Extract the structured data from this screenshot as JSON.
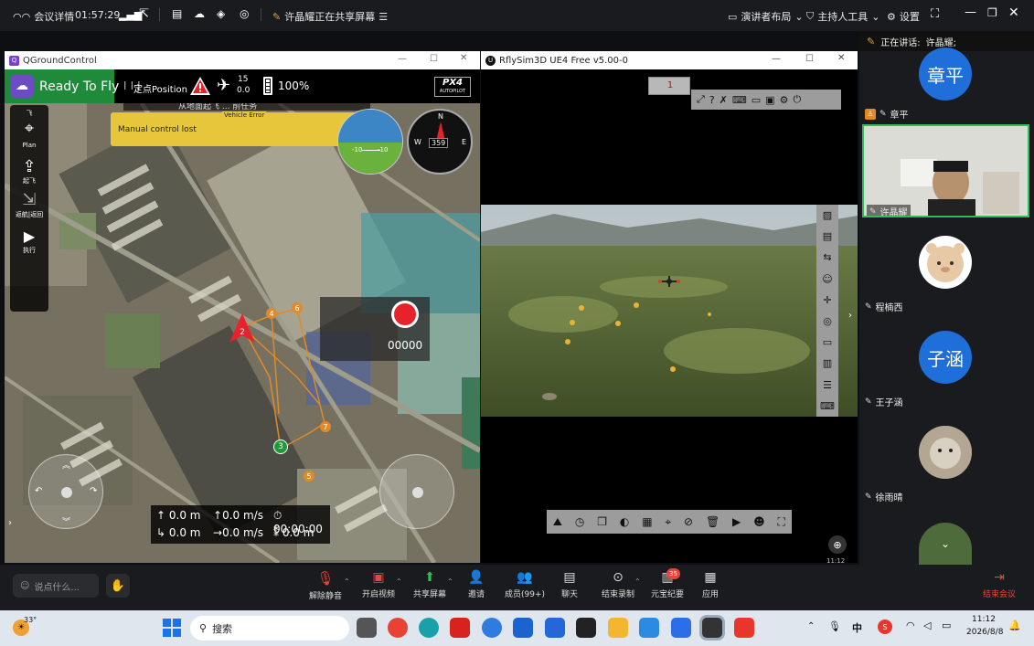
{
  "topbar": {
    "meeting_label": "会议详情",
    "time": "01:57:29",
    "sharing_text": "许晶耀正在共享屏幕",
    "layout_label": "演讲者布局",
    "host_tools_label": "主持人工具",
    "settings_label": "设置"
  },
  "qgc": {
    "window_title": "QGroundControl",
    "status": "Ready To Fly",
    "flight_mode": "定点Position",
    "satellites": "15",
    "hdop": "0.0",
    "battery": "100%",
    "brand": "PX4",
    "brand_sub": "AUTOPILOT",
    "toolbar": {
      "top_label": "飞",
      "plan": "Plan",
      "takeoff": "起飞",
      "return": "返航|返回",
      "execute": "执行"
    },
    "banner_text": "从地面起飞 ... 前任务",
    "vehicle_error_title": "Vehicle Error",
    "vehicle_error_msg": "Manual control lost",
    "compass_heading": "359",
    "compass_n": "N",
    "compass_e": "E",
    "compass_w": "W",
    "attitude_left": "-10",
    "attitude_right": "-10",
    "record_counter": "00000",
    "telemetry": {
      "alt": "0.0 m",
      "vspeed": "0.0 m/s",
      "time": "00:00:00",
      "dist": "0.0 m",
      "hspeed": "0.0 m/s",
      "dist_home": "0.0 m"
    },
    "waypoints": [
      "2",
      "3",
      "4",
      "5",
      "6",
      "7"
    ]
  },
  "rfly": {
    "window_title": "RflySim3D UE4 Free v5.00-0",
    "vehicle_id_badge": "1",
    "clock": "11:12"
  },
  "participants": {
    "speaking_label": "正在讲话:",
    "speaking_name": "许晶耀;",
    "list": [
      {
        "name": "章平",
        "avatar_text": "章平",
        "avatar_color": "#1e6fd9"
      },
      {
        "name": "许晶耀",
        "avatar_text": "",
        "avatar_color": "#b7a38c"
      },
      {
        "name": "程楠西",
        "avatar_text": "",
        "avatar_color": "#e8c9a5"
      },
      {
        "name": "王子涵",
        "avatar_text": "子涵",
        "avatar_color": "#1e6fd9"
      },
      {
        "name": "徐雨晴",
        "avatar_text": "",
        "avatar_color": "#9a8d7b"
      },
      {
        "name": "",
        "avatar_text": "",
        "avatar_color": "#4d6b3b"
      }
    ]
  },
  "toolbar": {
    "chat_placeholder": "说点什么...",
    "unmute": "解除静音",
    "video": "开启视频",
    "share": "共享屏幕",
    "invite": "邀请",
    "members": "成员(99+)",
    "chat": "聊天",
    "record": "结束录制",
    "yuanbao": "元宝纪要",
    "yuanbao_badge": "35",
    "apps": "应用",
    "end": "结束会议"
  },
  "taskbar": {
    "weather": "33°",
    "search": "搜索",
    "ime": "中",
    "time": "11:12",
    "date": "2026/8/8"
  },
  "colors": {
    "qgc_green": "#1e8a3a",
    "error_yellow": "#e8c63b",
    "record_red": "#e8222a",
    "end_red": "#e8463b",
    "highlight_green": "#2fbf5a"
  }
}
